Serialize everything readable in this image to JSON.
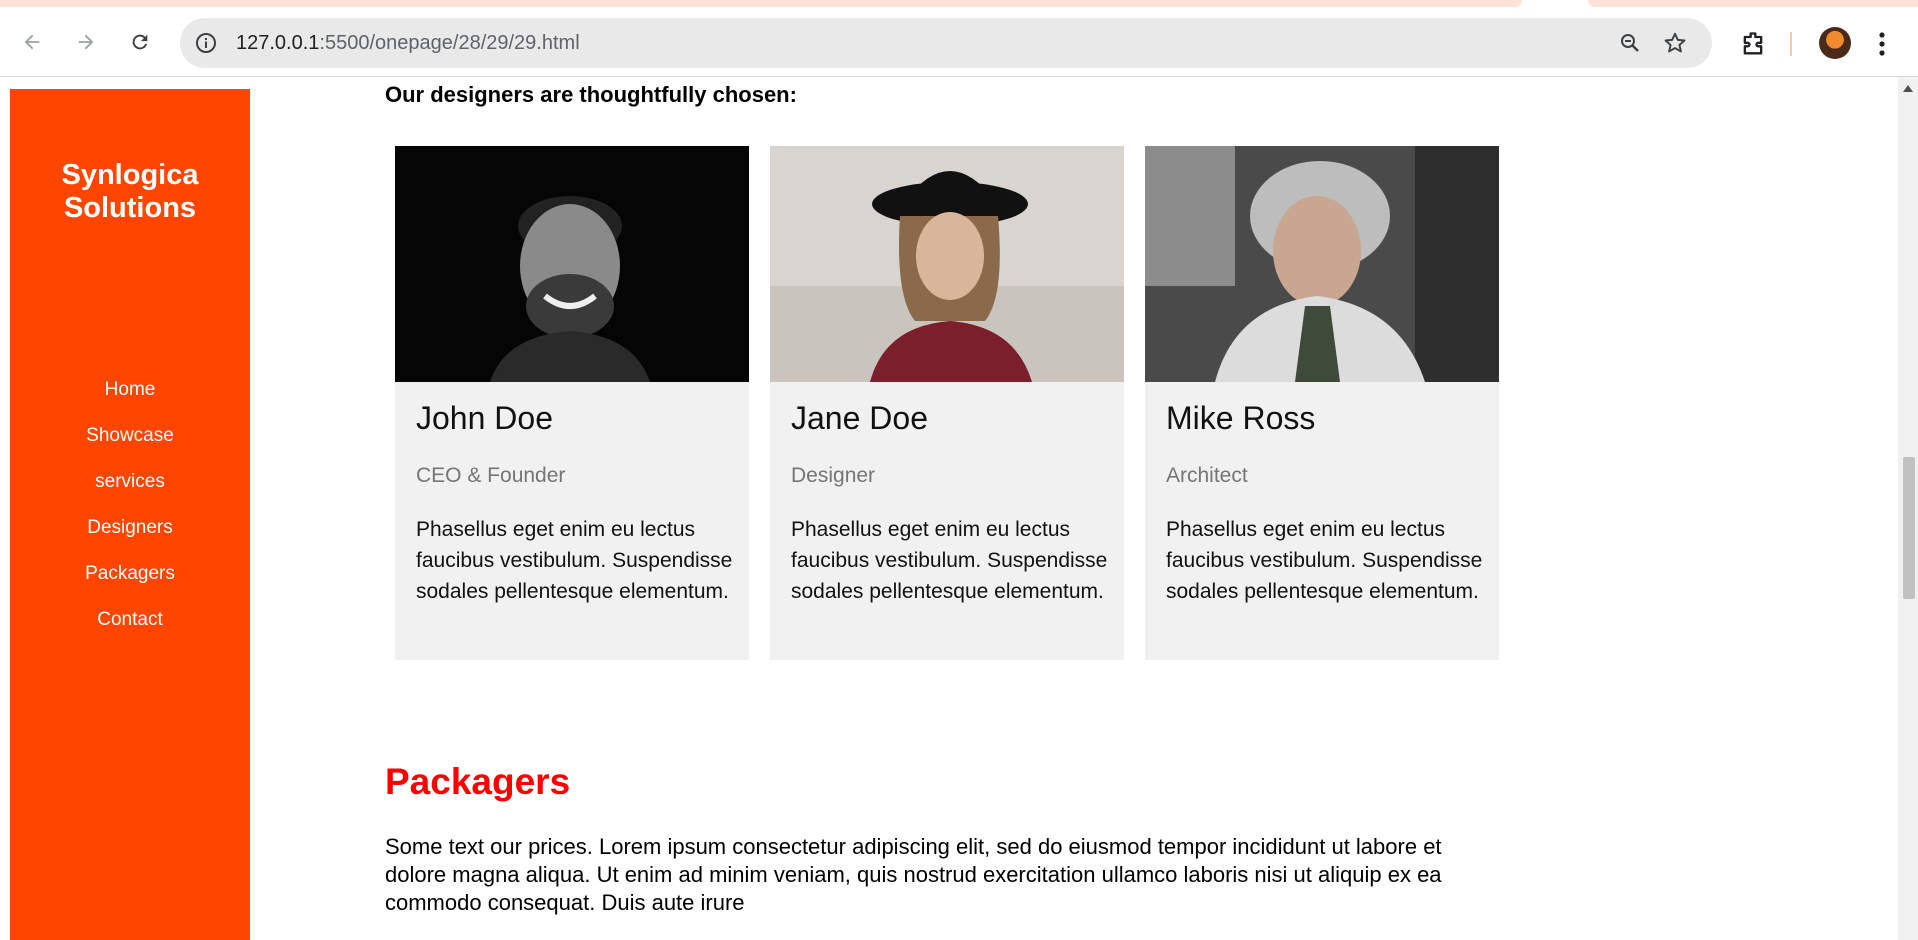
{
  "browser": {
    "url_host": "127.0.0.1",
    "url_rest": ":5500/onepage/28/29/29.html",
    "colors": {
      "tab_strip": "#fde3d6",
      "omnibox": "#e9e9ea"
    },
    "icons": [
      "back-arrow-icon",
      "forward-arrow-icon",
      "reload-icon",
      "site-info-icon",
      "zoom-icon",
      "bookmark-star-icon",
      "extensions-icon",
      "profile-avatar",
      "kebab-menu-icon"
    ]
  },
  "sidebar": {
    "brand_line1": "Synlogica",
    "brand_line2": "Solutions",
    "items": [
      {
        "label": "Home"
      },
      {
        "label": "Showcase"
      },
      {
        "label": "services"
      },
      {
        "label": "Designers"
      },
      {
        "label": "Packagers"
      },
      {
        "label": "Contact"
      }
    ],
    "color": "#ff4500"
  },
  "main": {
    "intro": "Our designers are thoughtfully chosen:",
    "designers": [
      {
        "name": "John Doe",
        "role": "CEO & Founder",
        "bio": "Phasellus eget enim eu lectus faucibus vestibulum. Suspendisse sodales pellentesque elementum."
      },
      {
        "name": "Jane Doe",
        "role": "Designer",
        "bio": "Phasellus eget enim eu lectus faucibus vestibulum. Suspendisse sodales pellentesque elementum."
      },
      {
        "name": "Mike Ross",
        "role": "Architect",
        "bio": "Phasellus eget enim eu lectus faucibus vestibulum. Suspendisse sodales pellentesque elementum."
      }
    ],
    "packagers_title": "Packagers",
    "packagers_text": "Some text our prices. Lorem ipsum consectetur adipiscing elit, sed do eiusmod tempor incididunt ut labore et dolore magna aliqua. Ut enim ad minim veniam, quis nostrud exercitation ullamco laboris nisi ut aliquip ex ea commodo consequat. Duis aute irure",
    "title_color": "#ff0000"
  }
}
